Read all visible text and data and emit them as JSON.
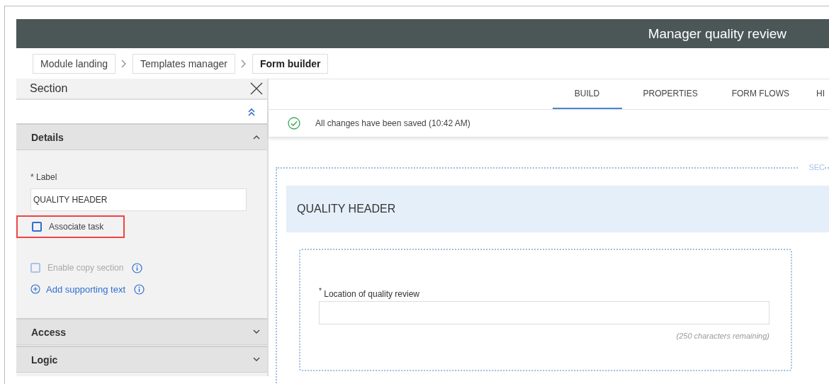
{
  "header": {
    "title": "Manager quality review"
  },
  "breadcrumbs": [
    {
      "label": "Module landing",
      "current": false
    },
    {
      "label": "Templates manager",
      "current": false
    },
    {
      "label": "Form builder",
      "current": true
    }
  ],
  "panel": {
    "title": "Section",
    "sections": [
      {
        "title": "Details",
        "expanded": true
      },
      {
        "title": "Access",
        "expanded": false
      },
      {
        "title": "Logic",
        "expanded": false
      }
    ],
    "label_field": {
      "label": "* Label",
      "value": "QUALITY HEADER"
    },
    "options": [
      {
        "kind": "checkbox",
        "label": "Associate task",
        "checked": false,
        "disabled": false,
        "highlighted": true,
        "info": false
      },
      {
        "kind": "checkbox",
        "label": "Enable copy section",
        "checked": false,
        "disabled": true,
        "highlighted": false,
        "info": true
      },
      {
        "kind": "link",
        "label": "Add supporting text",
        "highlighted": false,
        "info": true
      }
    ]
  },
  "tabs": [
    {
      "label": "BUILD",
      "selected": true
    },
    {
      "label": "PROPERTIES",
      "selected": false
    },
    {
      "label": "FORM FLOWS",
      "selected": false
    },
    {
      "label": "HI",
      "selected": false
    }
  ],
  "status": "All changes have been saved (10:42 AM)",
  "canvas": {
    "section_tag": "SEC",
    "section_title": "QUALITY HEADER",
    "field": {
      "required_mark": "*",
      "label": "Location of quality review",
      "hint": "(250 characters remaining)"
    }
  }
}
